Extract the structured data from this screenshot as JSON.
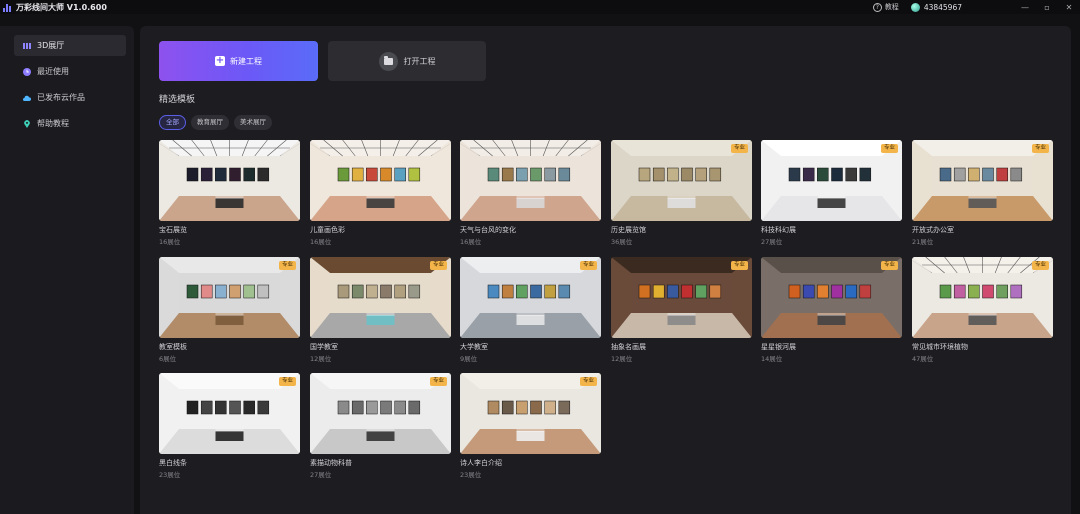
{
  "app": {
    "title": "万彩线间大师 V1.0.600",
    "help_label": "教程",
    "user_id": "43845967",
    "window_controls": [
      "—",
      "▫",
      "✕"
    ]
  },
  "sidebar": {
    "items": [
      {
        "label": "3D展厅",
        "icon": "grid-bars-icon",
        "active": true
      },
      {
        "label": "最近使用",
        "icon": "clock-icon",
        "active": false
      },
      {
        "label": "已发布云作品",
        "icon": "cloud-icon",
        "active": false
      },
      {
        "label": "帮助教程",
        "icon": "pin-icon",
        "active": false
      }
    ]
  },
  "actions": {
    "new_project": "新建工程",
    "open_project": "打开工程"
  },
  "templates": {
    "section_title": "精选模板",
    "filters": [
      {
        "label": "全部",
        "active": true
      },
      {
        "label": "教育展厅",
        "active": false
      },
      {
        "label": "美术展厅",
        "active": false
      }
    ],
    "pro_label": "专业",
    "cards": [
      {
        "title": "宝石展览",
        "slots": "16展位",
        "pro": false,
        "theme": "gem"
      },
      {
        "title": "儿童画色彩",
        "slots": "16展位",
        "pro": false,
        "theme": "kids"
      },
      {
        "title": "天气与台风的变化",
        "slots": "16展位",
        "pro": false,
        "theme": "weather"
      },
      {
        "title": "历史展览馆",
        "slots": "36展位",
        "pro": true,
        "theme": "history"
      },
      {
        "title": "科技科幻展",
        "slots": "27展位",
        "pro": true,
        "theme": "scifi"
      },
      {
        "title": "开放式办公室",
        "slots": "21展位",
        "pro": true,
        "theme": "office"
      },
      {
        "title": "教室模板",
        "slots": "6展位",
        "pro": true,
        "theme": "classroom"
      },
      {
        "title": "国学教室",
        "slots": "12展位",
        "pro": true,
        "theme": "guoxue"
      },
      {
        "title": "大学教室",
        "slots": "9展位",
        "pro": true,
        "theme": "college"
      },
      {
        "title": "抽象名画展",
        "slots": "12展位",
        "pro": true,
        "theme": "abstract"
      },
      {
        "title": "星星银河展",
        "slots": "14展位",
        "pro": true,
        "theme": "galaxy"
      },
      {
        "title": "常见城市环境植物",
        "slots": "47展位",
        "pro": true,
        "theme": "plants"
      },
      {
        "title": "黑白线条",
        "slots": "23展位",
        "pro": true,
        "theme": "bw"
      },
      {
        "title": "素描动物科普",
        "slots": "27展位",
        "pro": true,
        "theme": "sketch"
      },
      {
        "title": "诗人李白介绍",
        "slots": "23展位",
        "pro": true,
        "theme": "libai"
      }
    ]
  },
  "colors": {
    "accent_start": "#8e52ee",
    "accent_end": "#5a6cf8",
    "pro_badge": "#f3b54a"
  }
}
